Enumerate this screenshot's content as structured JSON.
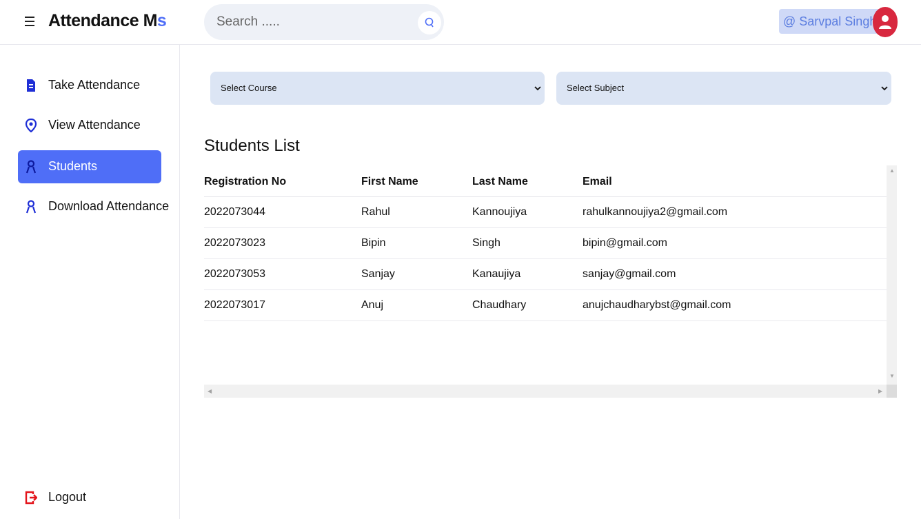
{
  "header": {
    "brand_main": "Attendance M",
    "brand_accent": "s",
    "search_placeholder": "Search .....",
    "user_tag": "@ Sarvpal Singh"
  },
  "sidebar": {
    "items": [
      {
        "label": "Take Attendance",
        "icon": "document-icon"
      },
      {
        "label": "View Attendance",
        "icon": "location-pin-icon"
      },
      {
        "label": "Students",
        "icon": "student-icon",
        "active": true
      },
      {
        "label": "Download Attendance",
        "icon": "student-icon"
      }
    ],
    "logout_label": "Logout"
  },
  "filters": {
    "course_label": "Select Course",
    "subject_label": "Select Subject"
  },
  "students": {
    "title": "Students List",
    "columns": [
      "Registration No",
      "First Name",
      "Last Name",
      "Email"
    ],
    "rows": [
      [
        "2022073044",
        "Rahul",
        "Kannoujiya",
        "rahulkannoujiya2@gmail.com"
      ],
      [
        "2022073023",
        "Bipin",
        "Singh",
        "bipin@gmail.com"
      ],
      [
        "2022073053",
        "Sanjay",
        "Kanaujiya",
        "sanjay@gmail.com"
      ],
      [
        "2022073017",
        "Anuj",
        "Chaudhary",
        "anujchaudharybst@gmail.com"
      ]
    ]
  },
  "colors": {
    "accent": "#4f6ef7",
    "nav_icon": "#1f2fd6",
    "logout_icon": "#e3141b",
    "avatar": "#d8283f",
    "select_bg": "#dce5f4"
  }
}
